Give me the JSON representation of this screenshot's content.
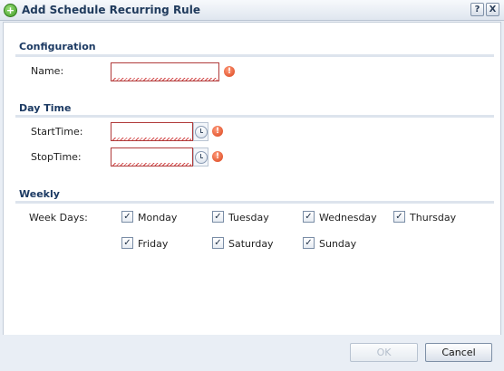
{
  "dialog": {
    "title": "Add Schedule Recurring Rule",
    "help_label": "?",
    "close_label": "X"
  },
  "configuration": {
    "section_title": "Configuration",
    "name_label": "Name:",
    "name_value": ""
  },
  "day_time": {
    "section_title": "Day Time",
    "start_label": "StartTime:",
    "start_value": "",
    "stop_label": "StopTime:",
    "stop_value": ""
  },
  "weekly": {
    "section_title": "Weekly",
    "week_days_label": "Week Days:",
    "days": [
      {
        "label": "Monday",
        "checked": true
      },
      {
        "label": "Tuesday",
        "checked": true
      },
      {
        "label": "Wednesday",
        "checked": true
      },
      {
        "label": "Thursday",
        "checked": true
      },
      {
        "label": "Friday",
        "checked": true
      },
      {
        "label": "Saturday",
        "checked": true
      },
      {
        "label": "Sunday",
        "checked": true
      }
    ]
  },
  "icons": {
    "error_glyph": "!",
    "check_glyph": "✓",
    "add_glyph": "+"
  },
  "buttons": {
    "ok_label": "OK",
    "ok_enabled": false,
    "cancel_label": "Cancel"
  }
}
